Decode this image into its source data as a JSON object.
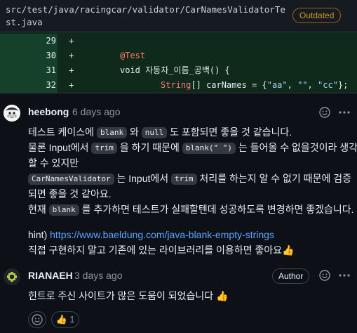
{
  "file": {
    "path": "src/test/java/racingcar/validator/CarNamesValidatorTest.java",
    "badge": "Outdated"
  },
  "diff": {
    "rows": [
      {
        "line": "29",
        "sign": "+"
      },
      {
        "line": "30",
        "sign": "+",
        "annotation": "@Test"
      },
      {
        "line": "31",
        "sign": "+",
        "code": "void 자동차_이름_공백() {"
      },
      {
        "line": "32",
        "sign": "+",
        "type": "String",
        "code_mid": "[] carNames = {",
        "s1": "\"aa\"",
        "c1": ", ",
        "s2": "\"\"",
        "c2": ", ",
        "s3": "\"cc\"",
        "end": "};"
      }
    ]
  },
  "comments": [
    {
      "author": "heebong",
      "time": "6 days ago",
      "l1a": "테스트 케이스에 ",
      "l1_chip1": "blank",
      "l1b": " 와 ",
      "l1_chip2": "null",
      "l1c": " 도 포함되면 좋을 것 같습니다.",
      "l2a": "물론 Input에서 ",
      "l2_chip1": "trim",
      "l2b": " 을 하기 때문에 ",
      "l2_chip2": "blank(\" \")",
      "l2c": " 는 들어올 수 없을것이라 생각",
      "l3": "할 수 있지만",
      "l4_chip": "CarNamesValidator",
      "l4a": " 는 Input에서 ",
      "l4_chip2": "trim",
      "l4b": " 처리를 하는지 알 수 없기 때문에 검증",
      "l5": "되면 좋을 것 같아요.",
      "l6a": "현재 ",
      "l6_chip": "blank",
      "l6b": " 를 추가하면 테스트가 실패할텐데 성공하도록 변경하면 좋겠습니다. ",
      "l6_emoji": "😄",
      "hint_label": "hint) ",
      "hint_url": "https://www.baeldung.com/java-blank-empty-strings",
      "l8": "직접 구현하지 말고 기존에 있는 라이브러리를 이용하면 좋아요",
      "l8_emoji": "👍"
    },
    {
      "author": "RIANAEH",
      "time": "3 days ago",
      "badge": "Author",
      "text": "힌트로 주신 사이트가 많은 도움이 되었습니다 ",
      "emoji": "👍",
      "reaction_emoji": "👍",
      "reaction_count": "1"
    }
  ],
  "icons": {
    "smiley": "smiley-icon",
    "more": "kebab-horizontal-icon"
  },
  "colors": {
    "background": "#0d1117",
    "added_line_bg": "#0f2a1b",
    "link": "#58a6ff",
    "outdated": "#d29922"
  }
}
